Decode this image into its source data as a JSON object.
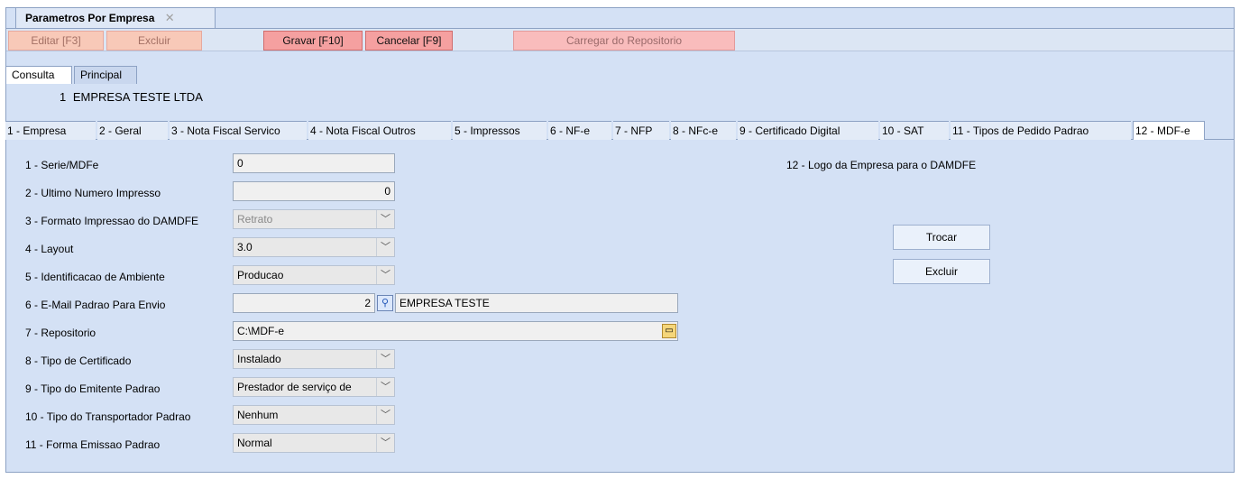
{
  "window": {
    "tab_title": "Parametros Por Empresa",
    "close_glyph": "✕"
  },
  "toolbar": {
    "edit": "Editar [F3]",
    "delete": "Excluir",
    "save": "Gravar [F10]",
    "cancel": "Cancelar [F9]",
    "load_repo": "Carregar do Repositorio"
  },
  "subtabs": [
    "Consulta",
    "Principal"
  ],
  "company": {
    "code": "1",
    "name": "EMPRESA TESTE LTDA"
  },
  "tabs": [
    "1 - Empresa",
    "2 - Geral",
    "3 - Nota Fiscal Servico",
    "4 - Nota Fiscal Outros",
    "5 - Impressos",
    "6 - NF-e",
    "7 - NFP",
    "8 - NFc-e",
    "9 - Certificado Digital",
    "10 - SAT",
    "11 - Tipos de Pedido Padrao",
    "12 - MDF-e"
  ],
  "active_tab": "12 - MDF-e",
  "form": {
    "serie_label": "1 - Serie/MDFe",
    "serie_value": "0",
    "ultimo_label": "2 - Ultimo Numero Impresso",
    "ultimo_value": "0",
    "formato_label": "3 - Formato Impressao do DAMDFE",
    "formato_value": "Retrato",
    "layout_label": "4 - Layout",
    "layout_value": "3.0",
    "ambiente_label": "5 - Identificacao de Ambiente",
    "ambiente_value": "Producao",
    "email_label": "6 - E-Mail Padrao Para Envio",
    "email_value": "2",
    "email_desc": "EMPRESA TESTE",
    "repositorio_label": "7 - Repositorio",
    "repositorio_value": "C:\\MDF-e",
    "certificado_label": "8 - Tipo de Certificado",
    "certificado_value": "Instalado",
    "emitente_label": "9 - Tipo do Emitente Padrao",
    "emitente_value": "Prestador de serviço de",
    "transportador_label": "10 - Tipo do Transportador Padrao",
    "transportador_value": "Nenhum",
    "emissao_label": "11 - Forma Emissao Padrao",
    "emissao_value": "Normal"
  },
  "logo": {
    "label": "12 - Logo da Empresa para o DAMDFE",
    "change": "Trocar",
    "delete": "Excluir"
  },
  "icons": {
    "search": "search-icon",
    "folder": "folder-icon",
    "dropdown": "chevron-down-icon"
  }
}
